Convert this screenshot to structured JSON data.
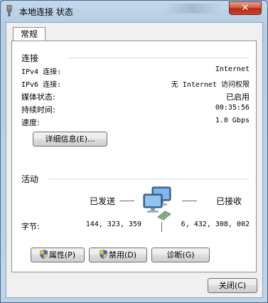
{
  "window": {
    "title": "本地连接 状态",
    "close_label": "✕"
  },
  "tabs": [
    {
      "label": "常规"
    }
  ],
  "connection": {
    "heading": "连接",
    "rows": [
      {
        "label": "IPv4 连接:",
        "value": "Internet"
      },
      {
        "label": "IPv6 连接:",
        "value": "无 Internet 访问权限"
      },
      {
        "label": "媒体状态:",
        "value": "已启用"
      },
      {
        "label": "持续时间:",
        "value": "00:35:56"
      },
      {
        "label": "速度:",
        "value": "1.0 Gbps"
      }
    ],
    "details_button": "详细信息(E)..."
  },
  "activity": {
    "heading": "活动",
    "sent_label": "已发送",
    "received_label": "已接收",
    "bytes_label": "字节:",
    "bytes_sent": "144, 323, 359",
    "bytes_received": "6, 432, 308, 002",
    "icon": "network-computers-icon"
  },
  "buttons": {
    "properties": "属性(P)",
    "disable": "禁用(D)",
    "diagnose": "诊断(G)",
    "close": "关闭(C)"
  }
}
